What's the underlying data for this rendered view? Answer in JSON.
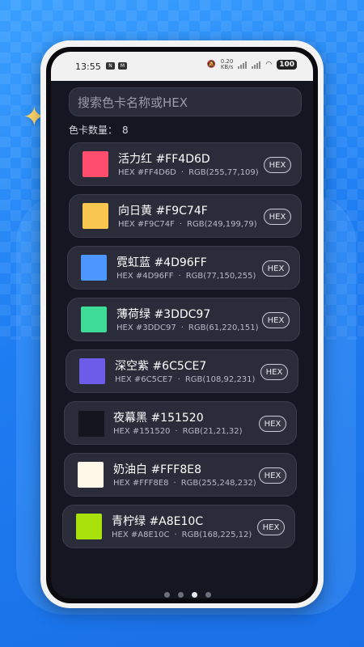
{
  "status_bar": {
    "time": "13:55",
    "app_icon_1": "N",
    "app_icon_2": "M",
    "net_speed": "0.20",
    "net_unit": "KB/s",
    "battery": "100",
    "icons": [
      "mute-icon",
      "signal-icon",
      "wifi-icon",
      "battery-icon"
    ]
  },
  "search": {
    "placeholder": "搜索色卡名称或HEX"
  },
  "summary": {
    "label": "色卡数量：",
    "value": "8"
  },
  "cards": [
    {
      "title": "活力红 #FF4D6D",
      "hex": "HEX #FF4D6D",
      "sep": "·",
      "rgb": "RGB(255,77,109)",
      "button": "HEX",
      "color": "#FF4D6D"
    },
    {
      "title": "向日黄 #F9C74F",
      "hex": "HEX #F9C74F",
      "sep": "·",
      "rgb": "RGB(249,199,79)",
      "button": "HEX",
      "color": "#F9C74F"
    },
    {
      "title": "霓虹蓝 #4D96FF",
      "hex": "HEX #4D96FF",
      "sep": "·",
      "rgb": "RGB(77,150,255)",
      "button": "HEX",
      "color": "#4D96FF"
    },
    {
      "title": "薄荷绿 #3DDC97",
      "hex": "HEX #3DDC97",
      "sep": "·",
      "rgb": "RGB(61,220,151)",
      "button": "HEX",
      "color": "#3DDC97"
    },
    {
      "title": "深空紫 #6C5CE7",
      "hex": "HEX #6C5CE7",
      "sep": "·",
      "rgb": "RGB(108,92,231)",
      "button": "HEX",
      "color": "#6C5CE7"
    },
    {
      "title": "夜幕黑 #151520",
      "hex": "HEX #151520",
      "sep": "·",
      "rgb": "RGB(21,21,32)",
      "button": "HEX",
      "color": "#151520"
    },
    {
      "title": "奶油白 #FFF8E8",
      "hex": "HEX #FFF8E8",
      "sep": "·",
      "rgb": "RGB(255,248,232)",
      "button": "HEX",
      "color": "#FFF8E8"
    },
    {
      "title": "青柠绿 #A8E10C",
      "hex": "HEX #A8E10C",
      "sep": "·",
      "rgb": "RGB(168,225,12)",
      "button": "HEX",
      "color": "#A8E10C"
    }
  ],
  "pager": {
    "pages": 4,
    "active_index": 2
  },
  "colors": {
    "background": "#1E7DF2",
    "screen": "#151621",
    "card": "#2A2C3A"
  }
}
